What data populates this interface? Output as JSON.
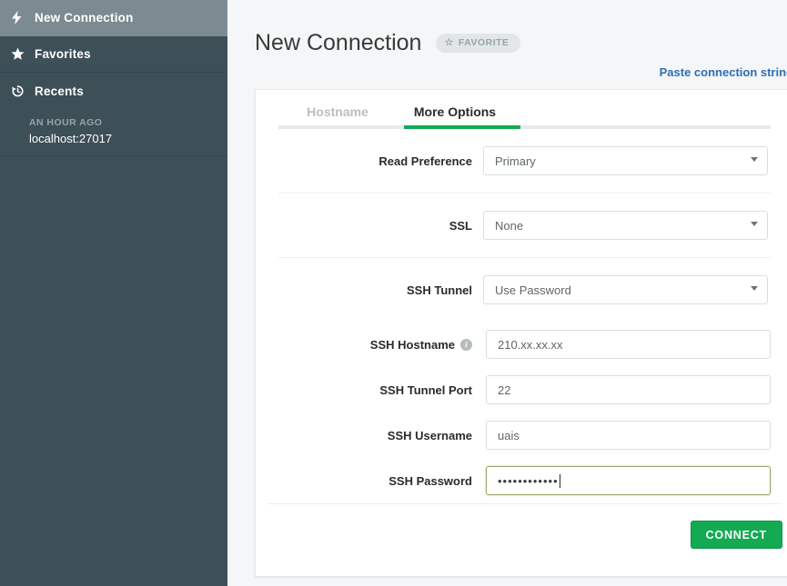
{
  "sidebar": {
    "items": [
      {
        "label": "New Connection",
        "icon": "bolt-icon",
        "active": true
      },
      {
        "label": "Favorites",
        "icon": "star-icon",
        "active": false
      },
      {
        "label": "Recents",
        "icon": "history-icon",
        "active": false
      }
    ],
    "recent": {
      "time": "AN HOUR AGO",
      "host": "localhost:27017"
    }
  },
  "header": {
    "title": "New Connection",
    "favorite_label": "FAVORITE",
    "favorite_star": "☆",
    "paste_link": "Paste connection string"
  },
  "tabs": [
    {
      "label": "Hostname",
      "active": false
    },
    {
      "label": "More Options",
      "active": true
    }
  ],
  "form": {
    "read_preference": {
      "label": "Read Preference",
      "value": "Primary"
    },
    "ssl": {
      "label": "SSL",
      "value": "None"
    },
    "ssh_tunnel": {
      "label": "SSH Tunnel",
      "value": "Use Password"
    },
    "ssh_hostname": {
      "label": "SSH Hostname",
      "value": "210.xx.xx.xx",
      "has_info": true
    },
    "ssh_tunnel_port": {
      "label": "SSH Tunnel Port",
      "value": "22"
    },
    "ssh_username": {
      "label": "SSH Username",
      "value": "uais"
    },
    "ssh_password": {
      "label": "SSH Password",
      "value": "••••••••••••",
      "focused": true
    }
  },
  "footer": {
    "connect_label": "CONNECT"
  },
  "colors": {
    "sidebar_bg": "#3d4f57",
    "sidebar_active": "#7c8b91",
    "accent_green": "#13aa52",
    "link_blue": "#2f6fb2",
    "focus_border": "#94a86b"
  }
}
